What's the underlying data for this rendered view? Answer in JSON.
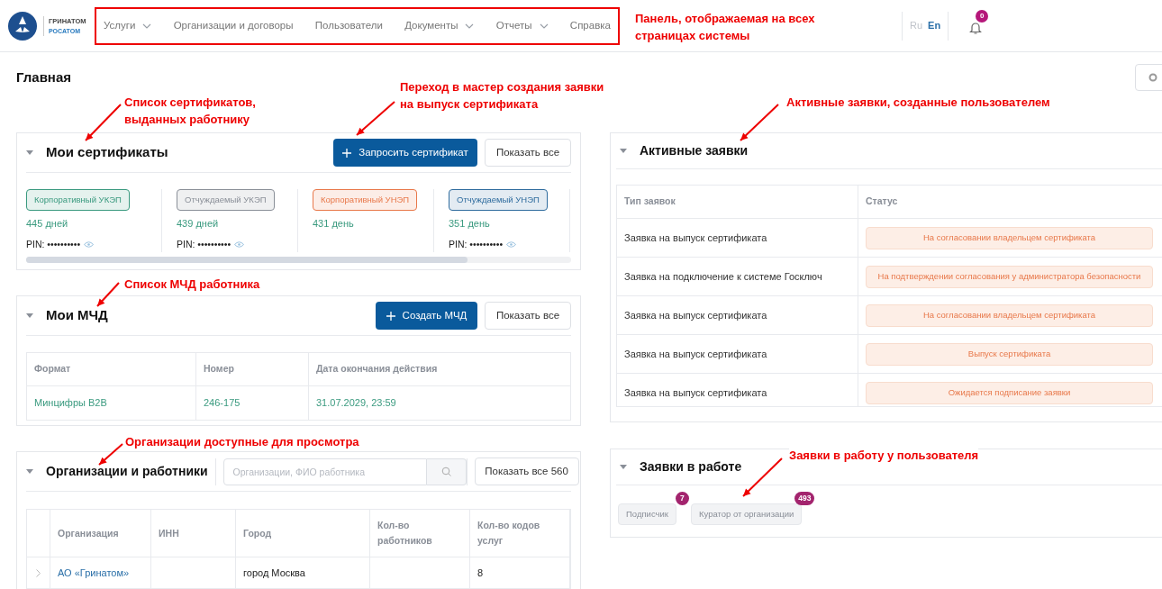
{
  "header": {
    "logo": {
      "lines": [
        "ГРИНАТОМ",
        "РОСАТОМ"
      ]
    },
    "nav": [
      {
        "label": "Услуги",
        "has_menu": true
      },
      {
        "label": "Организации и договоры",
        "has_menu": false
      },
      {
        "label": "Пользователи",
        "has_menu": false
      },
      {
        "label": "Документы",
        "has_menu": true
      },
      {
        "label": "Отчеты",
        "has_menu": true
      },
      {
        "label": "Справка",
        "has_menu": false
      }
    ],
    "languages": [
      {
        "label": "Ru",
        "selected": false
      },
      {
        "label": "En",
        "selected": true
      }
    ],
    "notifications": {
      "count": "0"
    }
  },
  "page_title": "Главная",
  "certificates": {
    "title": "Мои сертификаты",
    "request_button": "Запросить сертификат",
    "show_all_button": "Показать все",
    "items": [
      {
        "tag": "Корпоративный УКЭП",
        "color": "#3a9a7f",
        "days": "445 дней",
        "pin": "PIN: ••••••••••"
      },
      {
        "tag": "Отчуждаемый УКЭП",
        "color": "#8a8f98",
        "days": "439 дней",
        "pin": "PIN: ••••••••••"
      },
      {
        "tag": "Корпоративный УНЭП",
        "color": "#e8784a",
        "days": "431 день"
      },
      {
        "tag": "Отчуждаемый УНЭП",
        "color": "#2f6c9e",
        "days": "351 день",
        "pin": "PIN: ••••••••••"
      }
    ]
  },
  "mchd": {
    "title": "Мои МЧД",
    "create_button": "Создать МЧД",
    "show_all_button": "Показать все",
    "columns": [
      "Формат",
      "Номер",
      "Дата окончания действия"
    ],
    "rows": [
      [
        "Минцифры В2В",
        "246-175",
        "31.07.2029, 23:59"
      ]
    ]
  },
  "organizations": {
    "title": "Организации и работники",
    "search": {
      "placeholder": "Организации, ФИО работника"
    },
    "show_all_button": "Показать все 560",
    "columns": [
      "Организация",
      "ИНН",
      "Город",
      "Кол-во работников",
      "Кол-во кодов услуг"
    ],
    "rows": [
      {
        "organization": "АО «Гринатом»",
        "city": "город Москва",
        "service_codes": "8"
      }
    ]
  },
  "active_requests": {
    "title": "Активные заявки",
    "columns": [
      "Тип заявок",
      "Статус"
    ],
    "rows": [
      {
        "type": "Заявка на выпуск сертификата",
        "status": "На согласовании владельцем сертификата"
      },
      {
        "type": "Заявка на подключение к системе Госключ",
        "status": "На подтверждении согласования у администратора безопасности"
      },
      {
        "type": "Заявка на выпуск сертификата",
        "status": "На согласовании владельцем сертификата"
      },
      {
        "type": "Заявка на выпуск сертификата",
        "status": "Выпуск сертификата"
      },
      {
        "type": "Заявка на выпуск сертификата",
        "status": "Ожидается подписание заявки"
      }
    ]
  },
  "in_work": {
    "title": "Заявки в работе",
    "roles": [
      {
        "label": "Подписчик",
        "count": "7"
      },
      {
        "label": "Куратор от организации",
        "count": "493"
      }
    ]
  },
  "annotations": [
    {
      "lines": [
        "Панель, отображаемая на всех",
        "страницах системы"
      ]
    },
    {
      "lines": [
        "Список сертификатов,",
        "выданных работнику"
      ]
    },
    {
      "lines": [
        "Переход в мастер создания заявки",
        "на выпуск сертификата"
      ]
    },
    {
      "lines": [
        "Активные заявки, созданные пользователем"
      ]
    },
    {
      "lines": [
        "Список МЧД работника"
      ]
    },
    {
      "lines": [
        "Организации доступные для просмотра"
      ]
    },
    {
      "lines": [
        "Заявки в работу у пользователя"
      ]
    }
  ]
}
